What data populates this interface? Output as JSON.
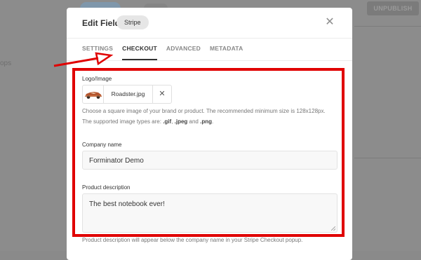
{
  "background": {
    "publish_label": "UNPUBLISH",
    "sidebar_text": "ops"
  },
  "modal": {
    "title": "Edit Field",
    "type_badge": "Stripe",
    "close_icon": "close-icon"
  },
  "tabs": [
    {
      "label": "SETTINGS",
      "active": false
    },
    {
      "label": "CHECKOUT",
      "active": true
    },
    {
      "label": "ADVANCED",
      "active": false
    },
    {
      "label": "METADATA",
      "active": false
    }
  ],
  "logo": {
    "label": "Logo/Image",
    "file_name": "Roadster.jpg",
    "remove_icon": "close-icon",
    "thumbnail_icon": "car-thumbnail",
    "help_line1": "Choose a square image of your brand or product. The recommended minimum size is 128x128px.",
    "help_line2_prefix": "The supported image types are: ",
    "help_type1": ".gif",
    "help_sep1": ", ",
    "help_type2": ".jpeg",
    "help_sep2": " and ",
    "help_type3": ".png",
    "help_end": "."
  },
  "company": {
    "label": "Company name",
    "value": "Forminator Demo"
  },
  "description": {
    "label": "Product description",
    "value": "The best notebook ever!",
    "help": "Product description will appear below the company name in your Stripe Checkout popup."
  },
  "annotation": {
    "color": "#e00000",
    "arrow_icon": "pointer-arrow"
  }
}
